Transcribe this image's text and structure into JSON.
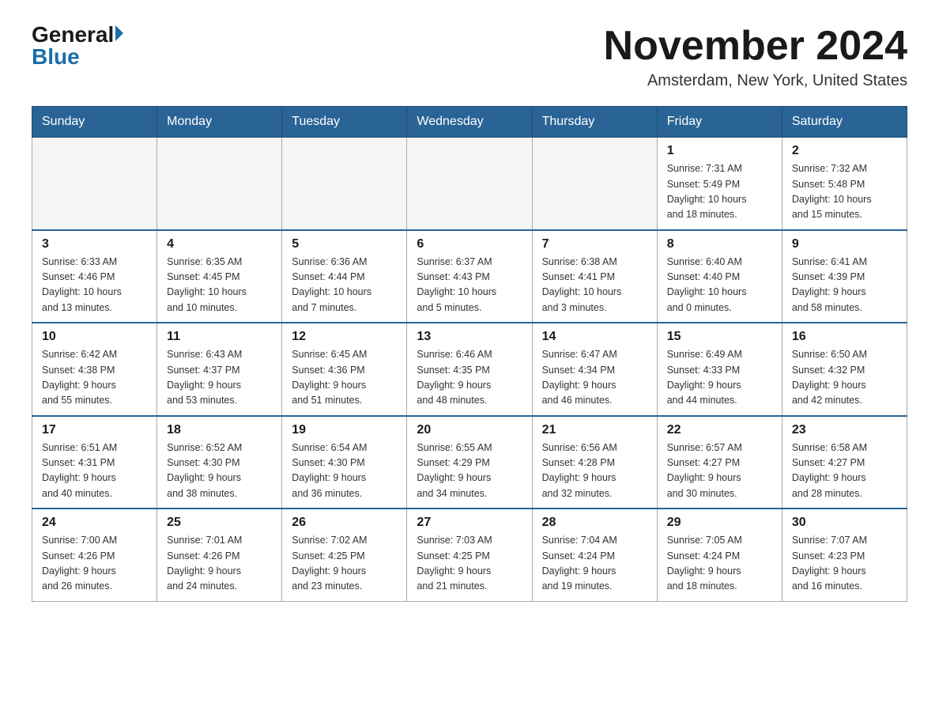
{
  "logo": {
    "general": "General",
    "blue": "Blue"
  },
  "title": "November 2024",
  "subtitle": "Amsterdam, New York, United States",
  "weekdays": [
    "Sunday",
    "Monday",
    "Tuesday",
    "Wednesday",
    "Thursday",
    "Friday",
    "Saturday"
  ],
  "weeks": [
    [
      {
        "day": "",
        "info": ""
      },
      {
        "day": "",
        "info": ""
      },
      {
        "day": "",
        "info": ""
      },
      {
        "day": "",
        "info": ""
      },
      {
        "day": "",
        "info": ""
      },
      {
        "day": "1",
        "info": "Sunrise: 7:31 AM\nSunset: 5:49 PM\nDaylight: 10 hours\nand 18 minutes."
      },
      {
        "day": "2",
        "info": "Sunrise: 7:32 AM\nSunset: 5:48 PM\nDaylight: 10 hours\nand 15 minutes."
      }
    ],
    [
      {
        "day": "3",
        "info": "Sunrise: 6:33 AM\nSunset: 4:46 PM\nDaylight: 10 hours\nand 13 minutes."
      },
      {
        "day": "4",
        "info": "Sunrise: 6:35 AM\nSunset: 4:45 PM\nDaylight: 10 hours\nand 10 minutes."
      },
      {
        "day": "5",
        "info": "Sunrise: 6:36 AM\nSunset: 4:44 PM\nDaylight: 10 hours\nand 7 minutes."
      },
      {
        "day": "6",
        "info": "Sunrise: 6:37 AM\nSunset: 4:43 PM\nDaylight: 10 hours\nand 5 minutes."
      },
      {
        "day": "7",
        "info": "Sunrise: 6:38 AM\nSunset: 4:41 PM\nDaylight: 10 hours\nand 3 minutes."
      },
      {
        "day": "8",
        "info": "Sunrise: 6:40 AM\nSunset: 4:40 PM\nDaylight: 10 hours\nand 0 minutes."
      },
      {
        "day": "9",
        "info": "Sunrise: 6:41 AM\nSunset: 4:39 PM\nDaylight: 9 hours\nand 58 minutes."
      }
    ],
    [
      {
        "day": "10",
        "info": "Sunrise: 6:42 AM\nSunset: 4:38 PM\nDaylight: 9 hours\nand 55 minutes."
      },
      {
        "day": "11",
        "info": "Sunrise: 6:43 AM\nSunset: 4:37 PM\nDaylight: 9 hours\nand 53 minutes."
      },
      {
        "day": "12",
        "info": "Sunrise: 6:45 AM\nSunset: 4:36 PM\nDaylight: 9 hours\nand 51 minutes."
      },
      {
        "day": "13",
        "info": "Sunrise: 6:46 AM\nSunset: 4:35 PM\nDaylight: 9 hours\nand 48 minutes."
      },
      {
        "day": "14",
        "info": "Sunrise: 6:47 AM\nSunset: 4:34 PM\nDaylight: 9 hours\nand 46 minutes."
      },
      {
        "day": "15",
        "info": "Sunrise: 6:49 AM\nSunset: 4:33 PM\nDaylight: 9 hours\nand 44 minutes."
      },
      {
        "day": "16",
        "info": "Sunrise: 6:50 AM\nSunset: 4:32 PM\nDaylight: 9 hours\nand 42 minutes."
      }
    ],
    [
      {
        "day": "17",
        "info": "Sunrise: 6:51 AM\nSunset: 4:31 PM\nDaylight: 9 hours\nand 40 minutes."
      },
      {
        "day": "18",
        "info": "Sunrise: 6:52 AM\nSunset: 4:30 PM\nDaylight: 9 hours\nand 38 minutes."
      },
      {
        "day": "19",
        "info": "Sunrise: 6:54 AM\nSunset: 4:30 PM\nDaylight: 9 hours\nand 36 minutes."
      },
      {
        "day": "20",
        "info": "Sunrise: 6:55 AM\nSunset: 4:29 PM\nDaylight: 9 hours\nand 34 minutes."
      },
      {
        "day": "21",
        "info": "Sunrise: 6:56 AM\nSunset: 4:28 PM\nDaylight: 9 hours\nand 32 minutes."
      },
      {
        "day": "22",
        "info": "Sunrise: 6:57 AM\nSunset: 4:27 PM\nDaylight: 9 hours\nand 30 minutes."
      },
      {
        "day": "23",
        "info": "Sunrise: 6:58 AM\nSunset: 4:27 PM\nDaylight: 9 hours\nand 28 minutes."
      }
    ],
    [
      {
        "day": "24",
        "info": "Sunrise: 7:00 AM\nSunset: 4:26 PM\nDaylight: 9 hours\nand 26 minutes."
      },
      {
        "day": "25",
        "info": "Sunrise: 7:01 AM\nSunset: 4:26 PM\nDaylight: 9 hours\nand 24 minutes."
      },
      {
        "day": "26",
        "info": "Sunrise: 7:02 AM\nSunset: 4:25 PM\nDaylight: 9 hours\nand 23 minutes."
      },
      {
        "day": "27",
        "info": "Sunrise: 7:03 AM\nSunset: 4:25 PM\nDaylight: 9 hours\nand 21 minutes."
      },
      {
        "day": "28",
        "info": "Sunrise: 7:04 AM\nSunset: 4:24 PM\nDaylight: 9 hours\nand 19 minutes."
      },
      {
        "day": "29",
        "info": "Sunrise: 7:05 AM\nSunset: 4:24 PM\nDaylight: 9 hours\nand 18 minutes."
      },
      {
        "day": "30",
        "info": "Sunrise: 7:07 AM\nSunset: 4:23 PM\nDaylight: 9 hours\nand 16 minutes."
      }
    ]
  ]
}
